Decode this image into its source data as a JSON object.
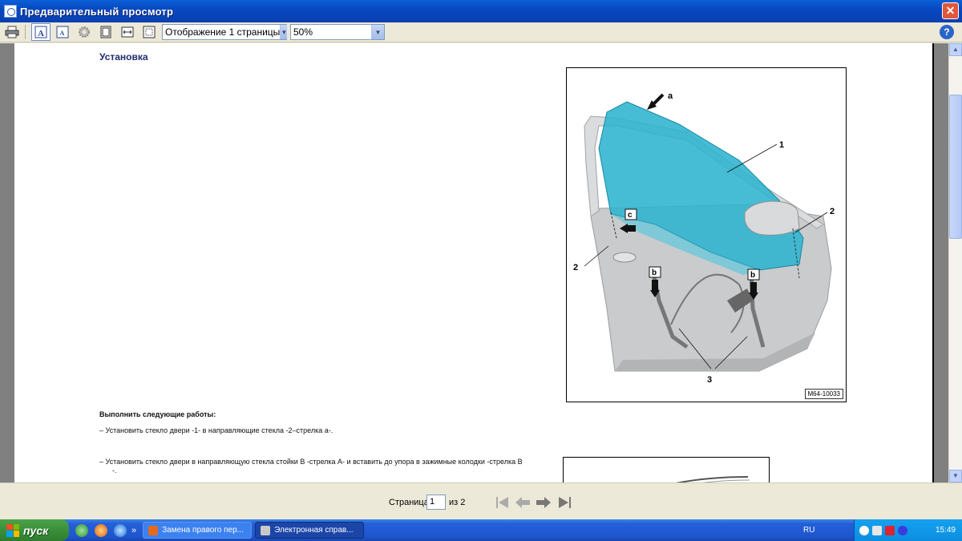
{
  "window": {
    "title": "Предварительный просмотр",
    "close_label": "✕"
  },
  "toolbar": {
    "view_mode": "Отображение 1 страницы",
    "zoom": "50%",
    "help_label": "?"
  },
  "document": {
    "section_title": "Установка",
    "figure": {
      "code": "M64-10033",
      "labels": {
        "a": "a",
        "b": "b",
        "c": "c",
        "n1": "1",
        "n2": "2",
        "n3": "3"
      }
    },
    "heading": "Выполнить следующие работы:",
    "steps": [
      "–    Установить стекло двери -1- в направляющие стекла -2–стрелка a-.",
      "–    Установить стекло двери в направляющую стекла стойки В -стрелка A- и вставить до упора в зажимные колодки -стрелка B"
    ],
    "step_tail": "-."
  },
  "pager": {
    "label_page": "Страница",
    "current": "1",
    "label_of": "из 2"
  },
  "taskbar": {
    "start_label": "пуск",
    "quicklaunch_more": "»",
    "tasks": [
      "Замена правого пер...",
      "Электронная справ..."
    ],
    "tray_lang": "RU",
    "clock": "15:49"
  }
}
